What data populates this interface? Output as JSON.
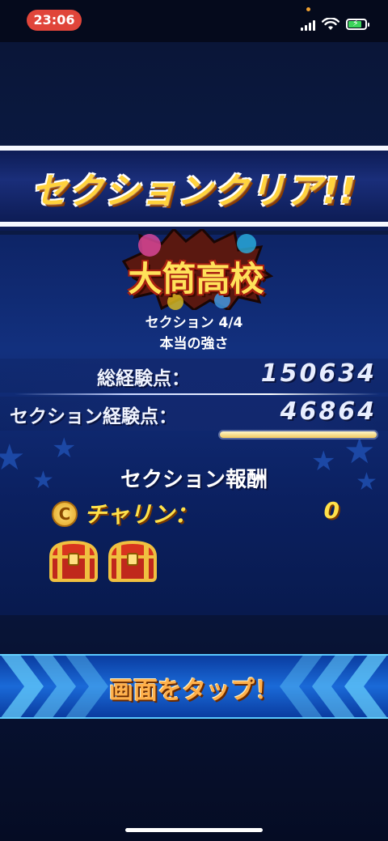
{
  "status_bar": {
    "time": "23:06"
  },
  "banner": {
    "title": "セクションクリア!!"
  },
  "emblem": {
    "text": "大筒高校"
  },
  "section": {
    "progress_label": "セクション 4/4",
    "subtitle": "本当の強さ"
  },
  "stats": {
    "total_exp_label": "総経験点：",
    "total_exp_value": "150634",
    "section_exp_label": "セクション経験点：",
    "section_exp_value": "46864",
    "section_exp_bar_fraction": 1.0
  },
  "reward": {
    "title": "セクション報酬",
    "currency_icon": "coin-icon",
    "currency_label": "チャリン：",
    "currency_value": "0",
    "chest_icon": "treasure-chest-icon",
    "chest_count": 2
  },
  "tap_prompt": {
    "label": "画面をタップ！"
  },
  "colors": {
    "accent_gold": "#ffd23c",
    "panel_blue": "#12307e",
    "tap_band_blue": "#1a6ad8"
  }
}
